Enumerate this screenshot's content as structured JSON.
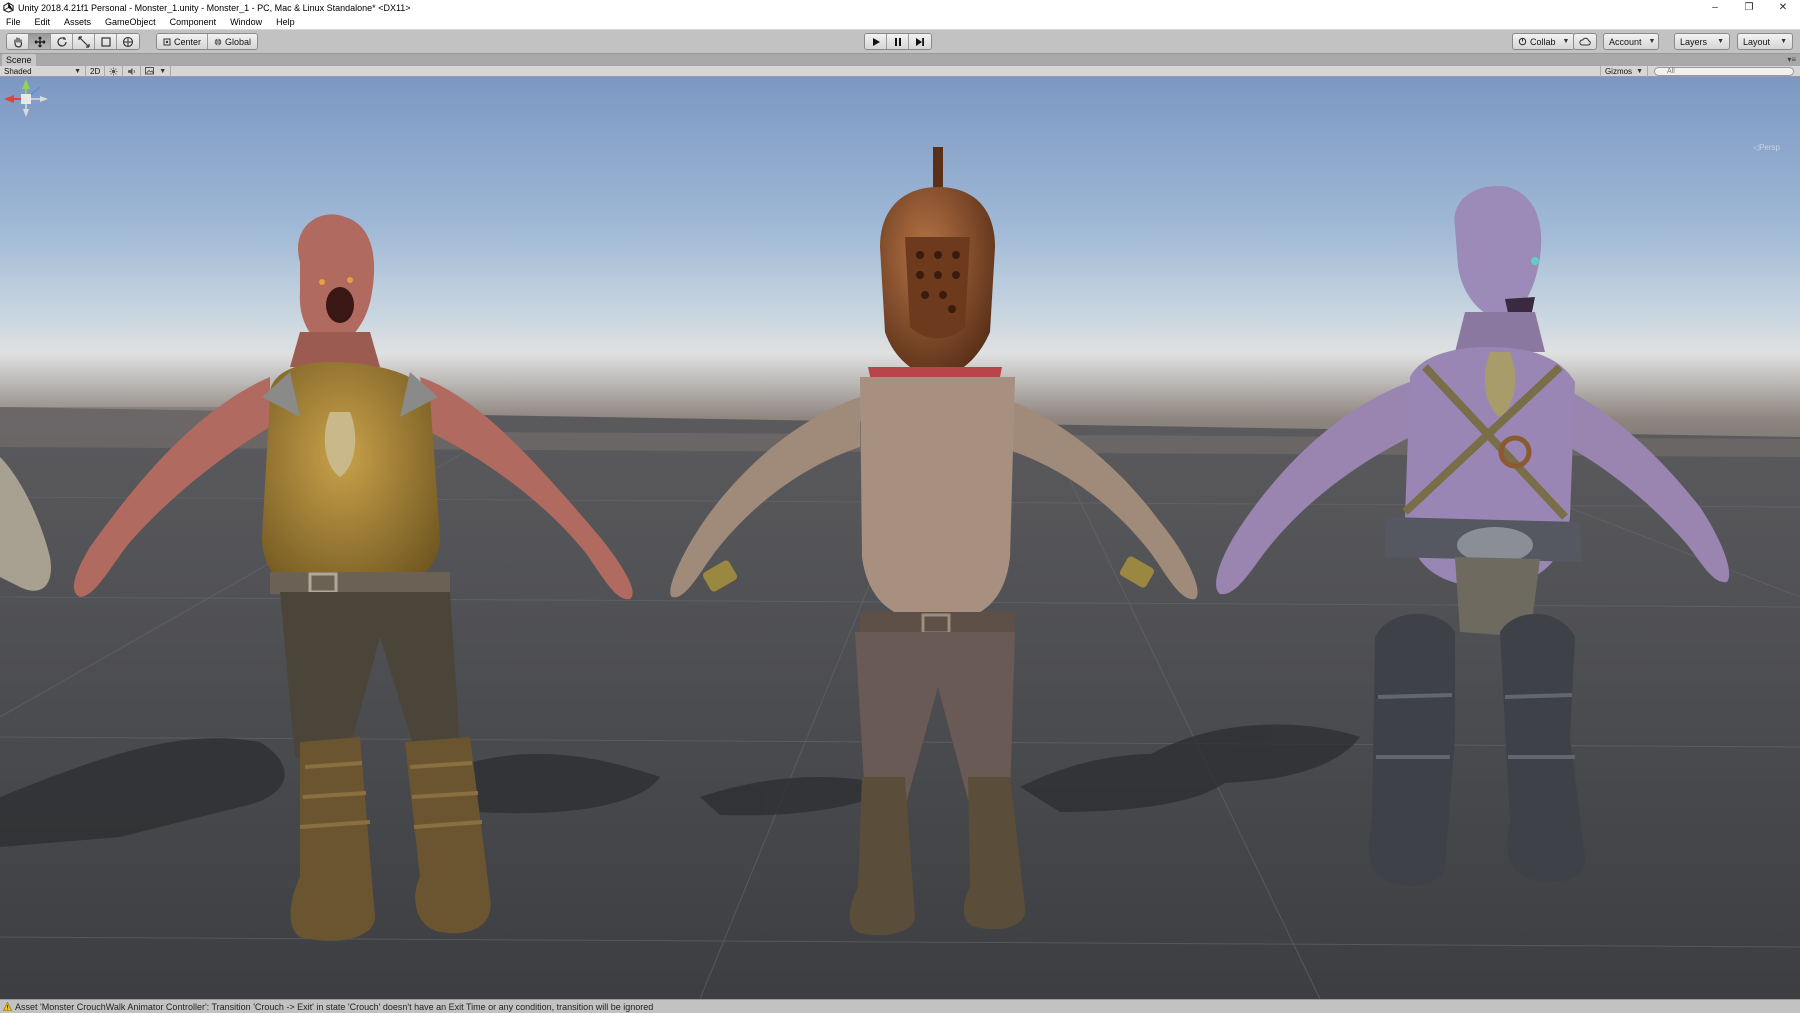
{
  "window": {
    "title": "Unity 2018.4.21f1 Personal - Monster_1.unity - Monster_1 - PC, Mac & Linux Standalone* <DX11>",
    "controls": [
      "–",
      "❐",
      "✕"
    ]
  },
  "menu": [
    "File",
    "Edit",
    "Assets",
    "GameObject",
    "Component",
    "Window",
    "Help"
  ],
  "toolbar": {
    "transform_tools": [
      "hand-tool",
      "move-tool",
      "rotate-tool",
      "scale-tool",
      "rect-tool",
      "transform-tool"
    ],
    "active_tool": "move-tool",
    "pivot_mode": "Center",
    "pivot_rotation": "Global",
    "collab_label": "Collab",
    "account_label": "Account",
    "layers_label": "Layers",
    "layout_label": "Layout"
  },
  "scene": {
    "tab_label": "Scene",
    "shading_mode": "Shaded",
    "mode_2d_label": "2D",
    "gizmos_label": "Gizmos",
    "search_placeholder": "All",
    "camera_label": "Persp"
  },
  "status": {
    "message": "Asset 'Monster CrouchWalk Animator Controller': Transition 'Crouch -> Exit' in state 'Crouch' doesn't have an Exit Time or any condition, transition will be ignored"
  },
  "colors": {
    "editor_bg": "#c2c2c2",
    "sky_top": "#7c97c2",
    "ground": "#45474b",
    "monster_left_skin": "#b06a5f",
    "monster_left_armor": "#a8842e",
    "gladiator_helmet": "#8a4f2a",
    "gladiator_scarf": "#b8454a",
    "monster_right_skin": "#9a84b0"
  }
}
